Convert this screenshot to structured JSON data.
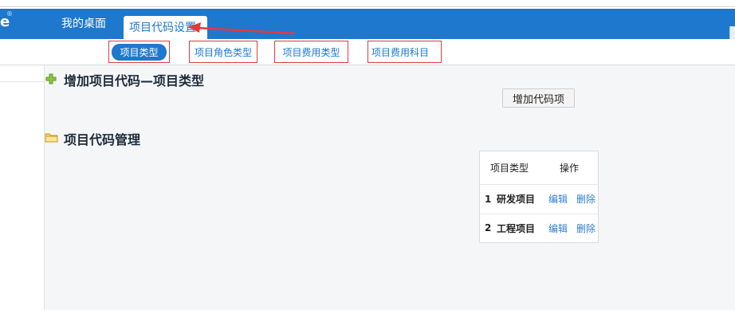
{
  "header": {
    "logo_fragment": "e",
    "logo_reg": "®",
    "nav_desk": "我的桌面",
    "nav_active_tab": "项目代码设置"
  },
  "subnav": {
    "items": [
      {
        "label": "项目类型",
        "active": true
      },
      {
        "label": "项目角色类型",
        "active": false
      },
      {
        "label": "项目费用类型",
        "active": false
      },
      {
        "label": "项目费用科目",
        "active": false
      }
    ]
  },
  "sections": {
    "add_title": "增加项目代码—项目类型",
    "add_button": "增加代码项",
    "manage_title": "项目代码管理"
  },
  "table": {
    "headers": [
      "项目类型",
      "操作"
    ],
    "rows": [
      {
        "num": "1",
        "name": "研发项目",
        "edit": "编辑",
        "delete": "删除"
      },
      {
        "num": "2",
        "name": "工程项目",
        "edit": "编辑",
        "delete": "删除"
      }
    ]
  },
  "colors": {
    "header_bg": "#1e78cd",
    "highlight_border": "#e23a3a",
    "link": "#2f7fd0"
  }
}
